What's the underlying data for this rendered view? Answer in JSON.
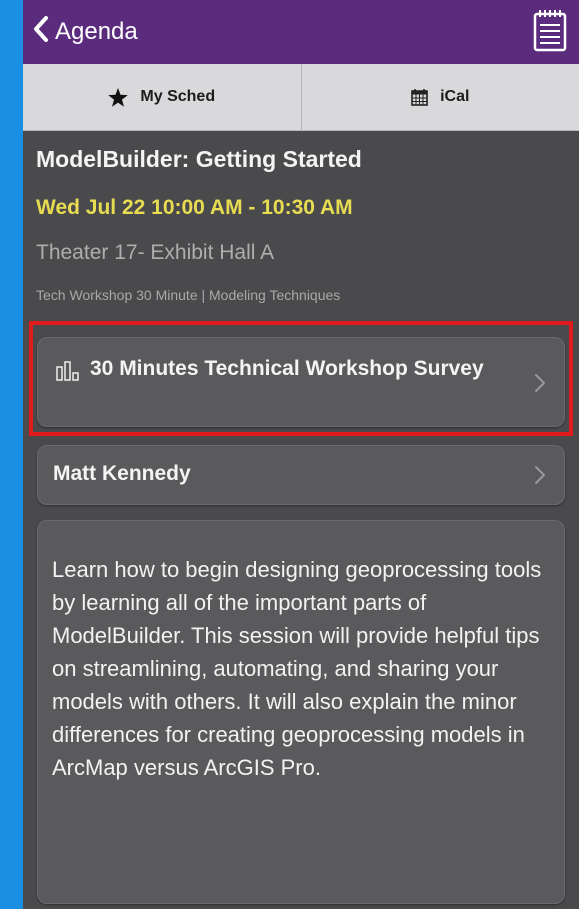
{
  "nav": {
    "back_label": "Agenda"
  },
  "toolbar": {
    "my_sched_label": "My Sched",
    "ical_label": "iCal"
  },
  "session": {
    "title": "ModelBuilder: Getting Started",
    "datetime": "Wed Jul 22 10:00 AM - 10:30 AM",
    "location": "Theater 17- Exhibit Hall A",
    "category": "Tech Workshop 30 Minute | Modeling Techniques"
  },
  "survey": {
    "label": "30 Minutes Technical Workshop Survey"
  },
  "speaker": {
    "name": "Matt Kennedy"
  },
  "description": "Learn how to begin designing geoprocessing tools by learning all of the important parts of ModelBuilder. This session will provide helpful tips on streamlining, automating, and sharing your models with others. It will also explain the minor differences for creating geoprocessing models in ArcMap versus ArcGIS Pro.",
  "colors": {
    "navbar": "#5b2c7e",
    "datetime": "#e8dc52",
    "highlight": "#e01b1b",
    "background": "#4a4a4c"
  },
  "icons": {
    "back": "chevron-left-icon",
    "notes": "notepad-icon",
    "my_sched": "star-icon",
    "ical": "calendar-icon",
    "survey": "bar-chart-icon",
    "disclosure": "chevron-right-icon"
  }
}
